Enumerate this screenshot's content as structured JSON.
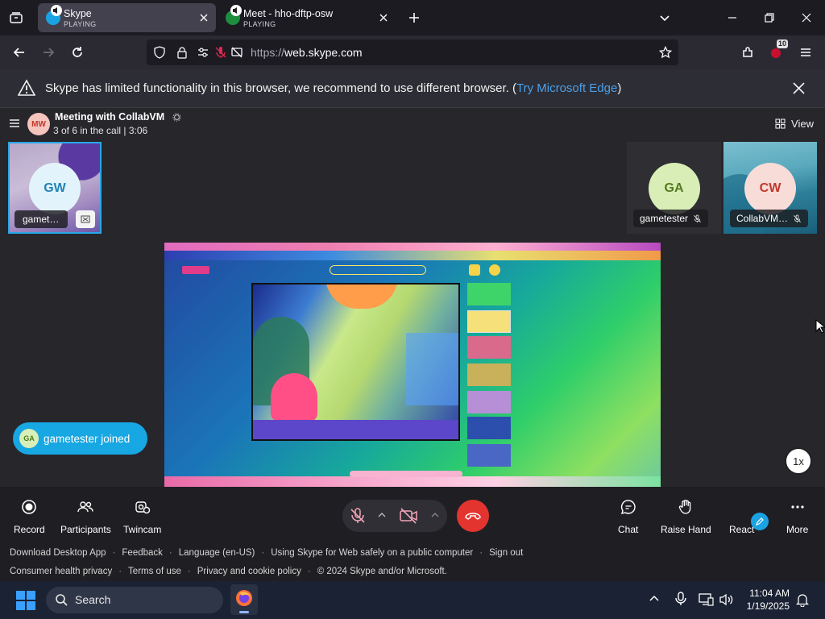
{
  "browser": {
    "tabs": [
      {
        "title": "Skype",
        "status": "PLAYING",
        "active": true
      },
      {
        "title": "Meet - hho-dftp-osw",
        "status": "PLAYING",
        "active": false
      }
    ],
    "url": {
      "prefix": "https://",
      "domain": "web.skype.com"
    },
    "extension_badge": "10"
  },
  "warning": {
    "text": "Skype has limited functionality in this browser, we recommend to use different browser. (",
    "link": "Try Microsoft Edge",
    "suffix": ")"
  },
  "meeting": {
    "avatar": "MW",
    "title": "Meeting with CollabVM",
    "status": "3 of 6 in the call | 3:06",
    "view_label": "View"
  },
  "participants": [
    {
      "initials": "GW",
      "name": "gamet…",
      "avatar_bg": "#e3f3fb",
      "avatar_fg": "#1f84b5"
    },
    {
      "initials": "GA",
      "name": "gametester",
      "avatar_bg": "#d9eeb6",
      "avatar_fg": "#567a1f"
    },
    {
      "initials": "CW",
      "name": "CollabVM…",
      "avatar_bg": "#f8dcd8",
      "avatar_fg": "#c0392b"
    }
  ],
  "toast": {
    "initials": "GA",
    "text": "gametester joined"
  },
  "speed": "1x",
  "controls": {
    "record": "Record",
    "participants": "Participants",
    "twincam": "Twincam",
    "chat": "Chat",
    "raise_hand": "Raise Hand",
    "react": "React",
    "more": "More"
  },
  "footer": {
    "row1": [
      "Download Desktop App",
      "Feedback",
      "Language (en-US)",
      "Using Skype for Web safely on a public computer",
      "Sign out"
    ],
    "row2": [
      "Consumer health privacy",
      "Terms of use",
      "Privacy and cookie policy",
      "© 2024 Skype and/or Microsoft."
    ]
  },
  "taskbar": {
    "search_label": "Search",
    "time": "11:04 AM",
    "date": "1/19/2025"
  },
  "colors": {
    "accent": "#17a7e3",
    "end_call": "#e3342f",
    "link": "#4ba0ea"
  }
}
